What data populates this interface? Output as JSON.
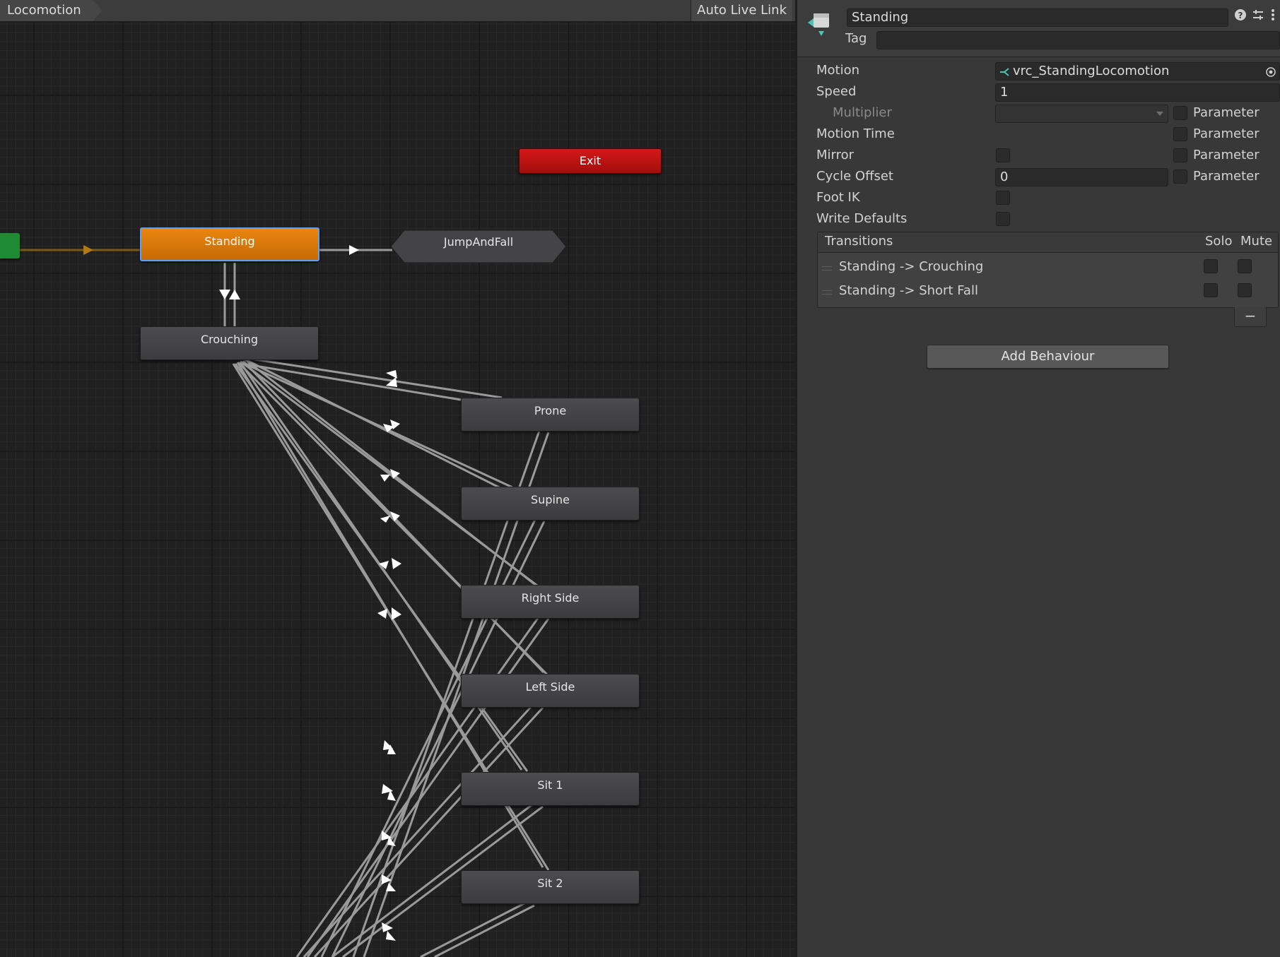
{
  "graph": {
    "breadcrumb": "Locomotion",
    "auto_live_link": "Auto Live Link",
    "states": {
      "standing": "Standing",
      "exit": "Exit",
      "jump_and_fall": "JumpAndFall",
      "crouching": "Crouching",
      "prone": "Prone",
      "supine": "Supine",
      "right_side": "Right Side",
      "left_side": "Left Side",
      "sit_1": "Sit 1",
      "sit_2": "Sit 2"
    }
  },
  "inspector": {
    "state_name": "Standing",
    "tag_label": "Tag",
    "tag_value": "",
    "motion": {
      "label": "Motion",
      "value": "vrc_StandingLocomotion"
    },
    "speed": {
      "label": "Speed",
      "value": "1"
    },
    "multiplier": {
      "label": "Multiplier",
      "value": ""
    },
    "motion_time": {
      "label": "Motion Time"
    },
    "mirror": {
      "label": "Mirror"
    },
    "cycle_offset": {
      "label": "Cycle Offset",
      "value": "0"
    },
    "foot_ik": {
      "label": "Foot IK"
    },
    "write_defaults": {
      "label": "Write Defaults"
    },
    "parameter_label": "Parameter",
    "transitions": {
      "header": "Transitions",
      "solo": "Solo",
      "mute": "Mute",
      "rows": [
        "Standing -> Crouching",
        "Standing -> Short Fall"
      ]
    },
    "minus": "−",
    "add_behaviour": "Add Behaviour"
  },
  "colors": {
    "default_state": "#d97508",
    "selection_outline": "#5aa0ff",
    "exit_state": "#c41414",
    "entry_state": "#1e8a33",
    "transition_line": "#9a9a9a"
  }
}
